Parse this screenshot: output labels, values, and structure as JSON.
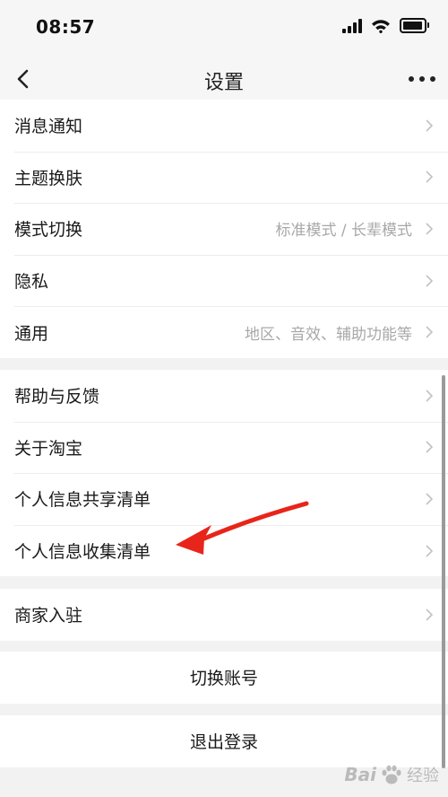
{
  "status_bar": {
    "time": "08:57",
    "icons": [
      "signal-icon",
      "wifi-icon",
      "battery-icon"
    ]
  },
  "nav": {
    "title": "设置",
    "back_icon": "chevron-left-icon",
    "more_icon": "more-dots-icon"
  },
  "groups": [
    {
      "items": [
        {
          "label": "消息通知",
          "value": ""
        },
        {
          "label": "主题换肤",
          "value": ""
        },
        {
          "label": "模式切换",
          "value": "标准模式 / 长辈模式"
        },
        {
          "label": "隐私",
          "value": ""
        },
        {
          "label": "通用",
          "value": "地区、音效、辅助功能等"
        }
      ]
    },
    {
      "items": [
        {
          "label": "帮助与反馈",
          "value": ""
        },
        {
          "label": "关于淘宝",
          "value": ""
        },
        {
          "label": "个人信息共享清单",
          "value": ""
        },
        {
          "label": "个人信息收集清单",
          "value": ""
        }
      ]
    },
    {
      "items": [
        {
          "label": "商家入驻",
          "value": ""
        }
      ]
    }
  ],
  "actions": {
    "switch_account": "切换账号",
    "logout": "退出登录"
  },
  "watermark": {
    "latin": "Bai",
    "cjk": "经验"
  },
  "colors": {
    "background": "#f2f2f2",
    "card": "#ffffff",
    "text": "#1a1a1a",
    "secondary_text": "#a8a8a8",
    "arrow": "#e8251a"
  }
}
